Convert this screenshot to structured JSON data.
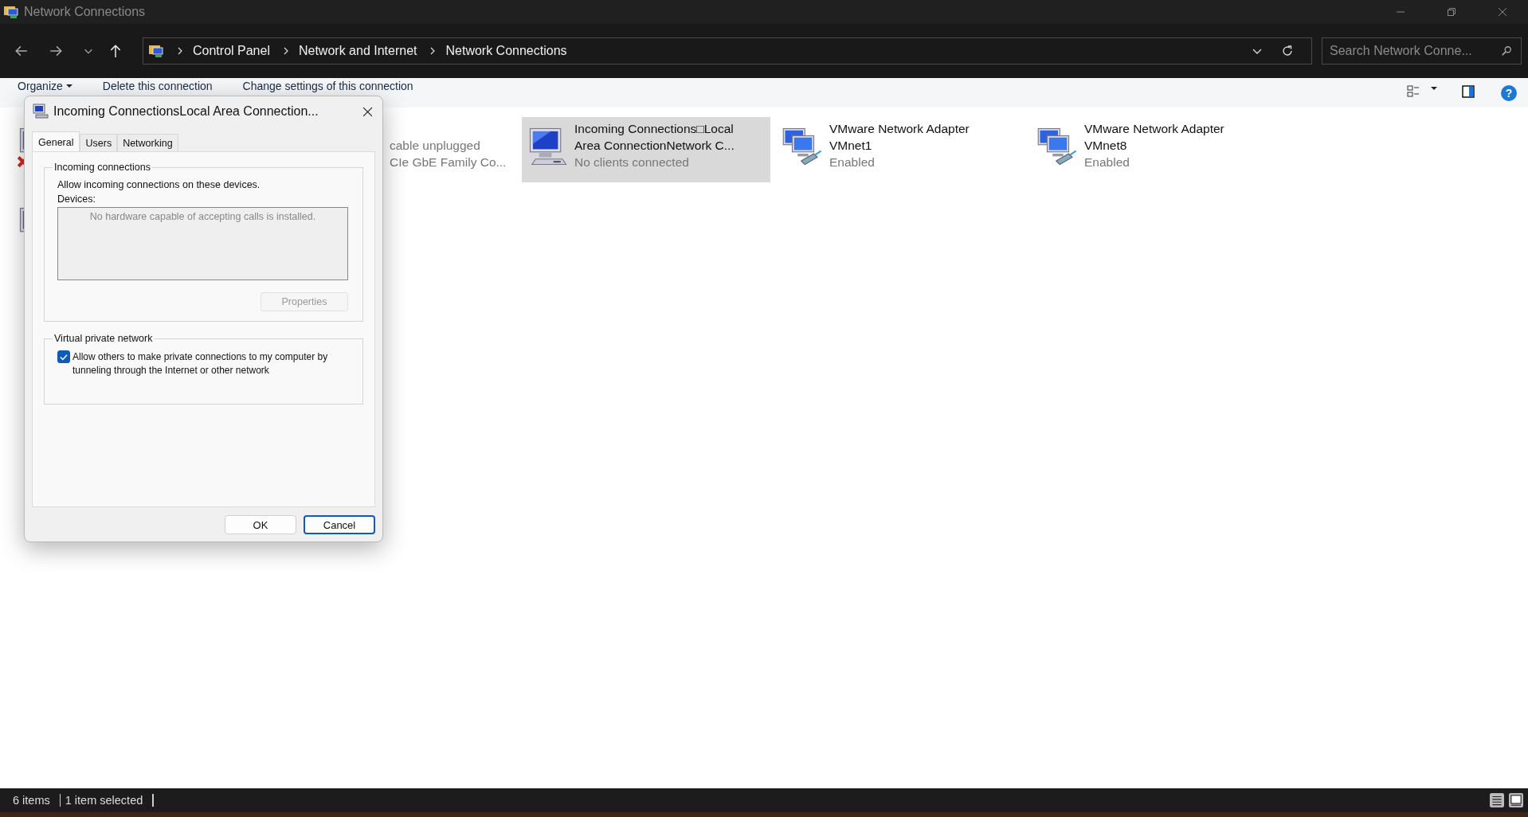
{
  "window": {
    "title": "Network Connections"
  },
  "address_bar": {
    "breadcrumbs": [
      "Control Panel",
      "Network and Internet",
      "Network Connections"
    ]
  },
  "search": {
    "placeholder": "Search Network Conne..."
  },
  "command_bar": {
    "commands": [
      "Organize",
      "Delete this connection",
      "Change settings of this connection"
    ],
    "help": "?"
  },
  "connections": [
    {
      "kind": "disconnected",
      "selected": false
    },
    {
      "status": "cable unplugged",
      "device": "CIe GbE Family Co...",
      "selected": false
    },
    {
      "kind": "incoming",
      "name_lines": [
        "Incoming Connections□Local",
        "Area ConnectionNetwork C..."
      ],
      "status": "No clients connected",
      "selected": true
    },
    {
      "kind": "adapter",
      "name_lines": [
        "VMware Network Adapter",
        "VMnet1"
      ],
      "status": "Enabled",
      "selected": false
    },
    {
      "kind": "adapter",
      "name_lines": [
        "VMware Network Adapter",
        "VMnet8"
      ],
      "status": "Enabled",
      "selected": false
    },
    {
      "kind": "network",
      "selected": false
    }
  ],
  "dialog": {
    "title": "Incoming ConnectionsLocal Area Connection...",
    "tabs": [
      {
        "label": "General",
        "selected": true
      },
      {
        "label": "Users",
        "selected": false
      },
      {
        "label": "Networking",
        "selected": false
      }
    ],
    "incoming_group": {
      "title": "Incoming connections",
      "description": "Allow incoming connections on these devices.",
      "devices_label": "Devices:",
      "devices_empty": "No hardware capable of accepting calls is installed.",
      "properties_button": {
        "label": "Properties",
        "disabled": true
      }
    },
    "vpn_group": {
      "title": "Virtual private network",
      "allow_option": {
        "label": "Allow others to make private connections to my computer by tunneling through the Internet or other network",
        "checked": true
      }
    },
    "buttons": [
      {
        "label": "OK",
        "default": false
      },
      {
        "label": "Cancel",
        "default": true
      }
    ]
  },
  "status_bar": {
    "item_count": "6 items",
    "selection": "1 item selected"
  }
}
